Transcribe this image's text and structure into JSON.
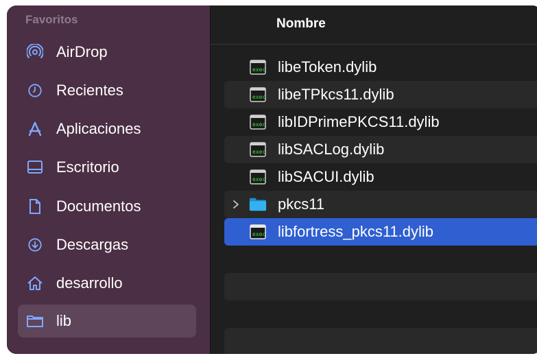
{
  "sidebar": {
    "heading": "Favoritos",
    "items": [
      {
        "label": "AirDrop",
        "icon": "airdrop-icon"
      },
      {
        "label": "Recientes",
        "icon": "clock-icon"
      },
      {
        "label": "Aplicaciones",
        "icon": "applications-icon"
      },
      {
        "label": "Escritorio",
        "icon": "desktop-icon"
      },
      {
        "label": "Documentos",
        "icon": "document-icon"
      },
      {
        "label": "Descargas",
        "icon": "download-icon"
      },
      {
        "label": "desarrollo",
        "icon": "home-icon"
      },
      {
        "label": "lib",
        "icon": "folder-icon",
        "selected": true
      }
    ]
  },
  "main": {
    "column_header": "Nombre",
    "files": [
      {
        "name": "libeToken.dylib",
        "icon": "executable-icon"
      },
      {
        "name": "libeTPkcs11.dylib",
        "icon": "executable-icon"
      },
      {
        "name": "libIDPrimePKCS11.dylib",
        "icon": "executable-icon"
      },
      {
        "name": "libSACLog.dylib",
        "icon": "executable-icon"
      },
      {
        "name": "libSACUI.dylib",
        "icon": "executable-icon"
      },
      {
        "name": "pkcs11",
        "icon": "folder-icon",
        "expandable": true
      },
      {
        "name": "libfortress_pkcs11.dylib",
        "icon": "executable-icon",
        "selected": true
      }
    ]
  },
  "colors": {
    "sidebar_bg": "#4b2f44",
    "accent_icon": "#7fa8ff",
    "selection": "#2f5fd0",
    "folder": "#29a8e8"
  }
}
